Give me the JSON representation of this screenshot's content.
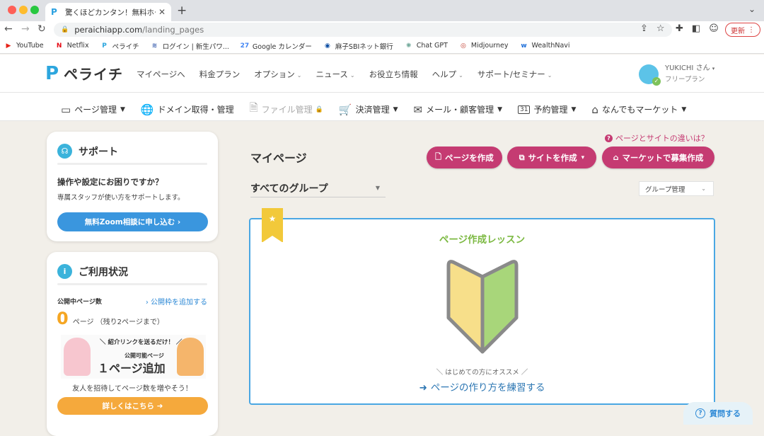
{
  "browser": {
    "tab_title": "驚くほどカンタン！無料ホームページ",
    "tab_favicon": "P",
    "url_domain": "peraichiapp.com",
    "url_path": "/landing_pages",
    "update_label": "更新",
    "bookmarks": [
      {
        "label": "YouTube",
        "icon": "youtube-icon",
        "color": "#e62117",
        "glyph": "▶"
      },
      {
        "label": "Netflix",
        "icon": "netflix-icon",
        "color": "#e50914",
        "glyph": "N"
      },
      {
        "label": "ペライチ",
        "icon": "peraichi-icon",
        "color": "#2ca6de",
        "glyph": "P"
      },
      {
        "label": "ログイン | 新生パワ...",
        "icon": "shinsei-icon",
        "color": "#3b5fae",
        "glyph": "≋"
      },
      {
        "label": "Google カレンダー",
        "icon": "calendar-icon",
        "color": "#4285f4",
        "glyph": "27"
      },
      {
        "label": "麻子SBIネット銀行",
        "icon": "sbi-icon",
        "color": "#0b4da2",
        "glyph": "◉"
      },
      {
        "label": "Chat GPT",
        "icon": "chatgpt-icon",
        "color": "#74aa9c",
        "glyph": "✺"
      },
      {
        "label": "Midjourney",
        "icon": "midjourney-icon",
        "color": "#c0392b",
        "glyph": "◎"
      },
      {
        "label": "WealthNavi",
        "icon": "wealthnavi-icon",
        "color": "#1e6fd9",
        "glyph": "w"
      }
    ]
  },
  "header": {
    "logo_text": "ペライチ",
    "nav": [
      {
        "label": "マイページへ",
        "dropdown": false
      },
      {
        "label": "料金プラン",
        "dropdown": false
      },
      {
        "label": "オプション",
        "dropdown": true
      },
      {
        "label": "ニュース",
        "dropdown": true
      },
      {
        "label": "お役立ち情報",
        "dropdown": false
      },
      {
        "label": "ヘルプ",
        "dropdown": true
      },
      {
        "label": "サポート/セミナー",
        "dropdown": true
      }
    ],
    "user_name": "YUKICHI さん",
    "user_plan": "フリープラン"
  },
  "subnav": [
    {
      "label": "ページ管理",
      "icon": "page-icon",
      "glyph": "▭",
      "dropdown": true,
      "disabled": false
    },
    {
      "label": "ドメイン取得・管理",
      "icon": "globe-icon",
      "glyph": "🌐",
      "dropdown": false,
      "disabled": false
    },
    {
      "label": "ファイル管理",
      "icon": "file-icon",
      "glyph": "🗎",
      "dropdown": false,
      "disabled": true
    },
    {
      "label": "決済管理",
      "icon": "cart-icon",
      "glyph": "🛒",
      "dropdown": true,
      "disabled": false
    },
    {
      "label": "メール・顧客管理",
      "icon": "mail-icon",
      "glyph": "✉",
      "dropdown": true,
      "disabled": false
    },
    {
      "label": "予約管理",
      "icon": "calendar-icon",
      "glyph": "31",
      "dropdown": true,
      "disabled": false
    },
    {
      "label": "なんでもマーケット",
      "icon": "market-icon",
      "glyph": "⌂",
      "dropdown": true,
      "disabled": false
    }
  ],
  "support": {
    "title": "サポート",
    "question": "操作や設定にお困りですか？",
    "description": "専属スタッフが使い方をサポートします。",
    "button": "無料Zoom相談に申し込む ›"
  },
  "usage": {
    "title": "ご利用状況",
    "published_label": "公開中ページ数",
    "add_link": "› 公開枠を追加する",
    "count": "0",
    "count_unit": "ページ （残り2ページまで）",
    "banner_line1": "＼ 紹介リンクを送るだけ！ ／",
    "banner_line2": "公開可能ページ",
    "banner_line3": "１ページ追加",
    "invite_text": "友人を招待してページ数を増やそう！",
    "more_button": "詳しくはこちら ➜"
  },
  "main": {
    "faq_link": "ページとサイトの違いは？",
    "title": "マイページ",
    "buttons": {
      "create_page": "ページを作成",
      "create_site": "サイトを作成",
      "market": "マーケットで募集作成"
    },
    "group_select": "すべてのグループ",
    "group_mgmt": "グループ管理"
  },
  "lesson": {
    "title": "ページ作成レッスン",
    "subtitle": "＼ はじめての方にオススメ ／",
    "link": "ページの作り方を練習する"
  },
  "help_button": "質問する",
  "colors": {
    "accent_pink": "#c53b72",
    "accent_blue": "#3a96de",
    "accent_orange": "#f5a93c",
    "lesson_green": "#7cb942"
  }
}
